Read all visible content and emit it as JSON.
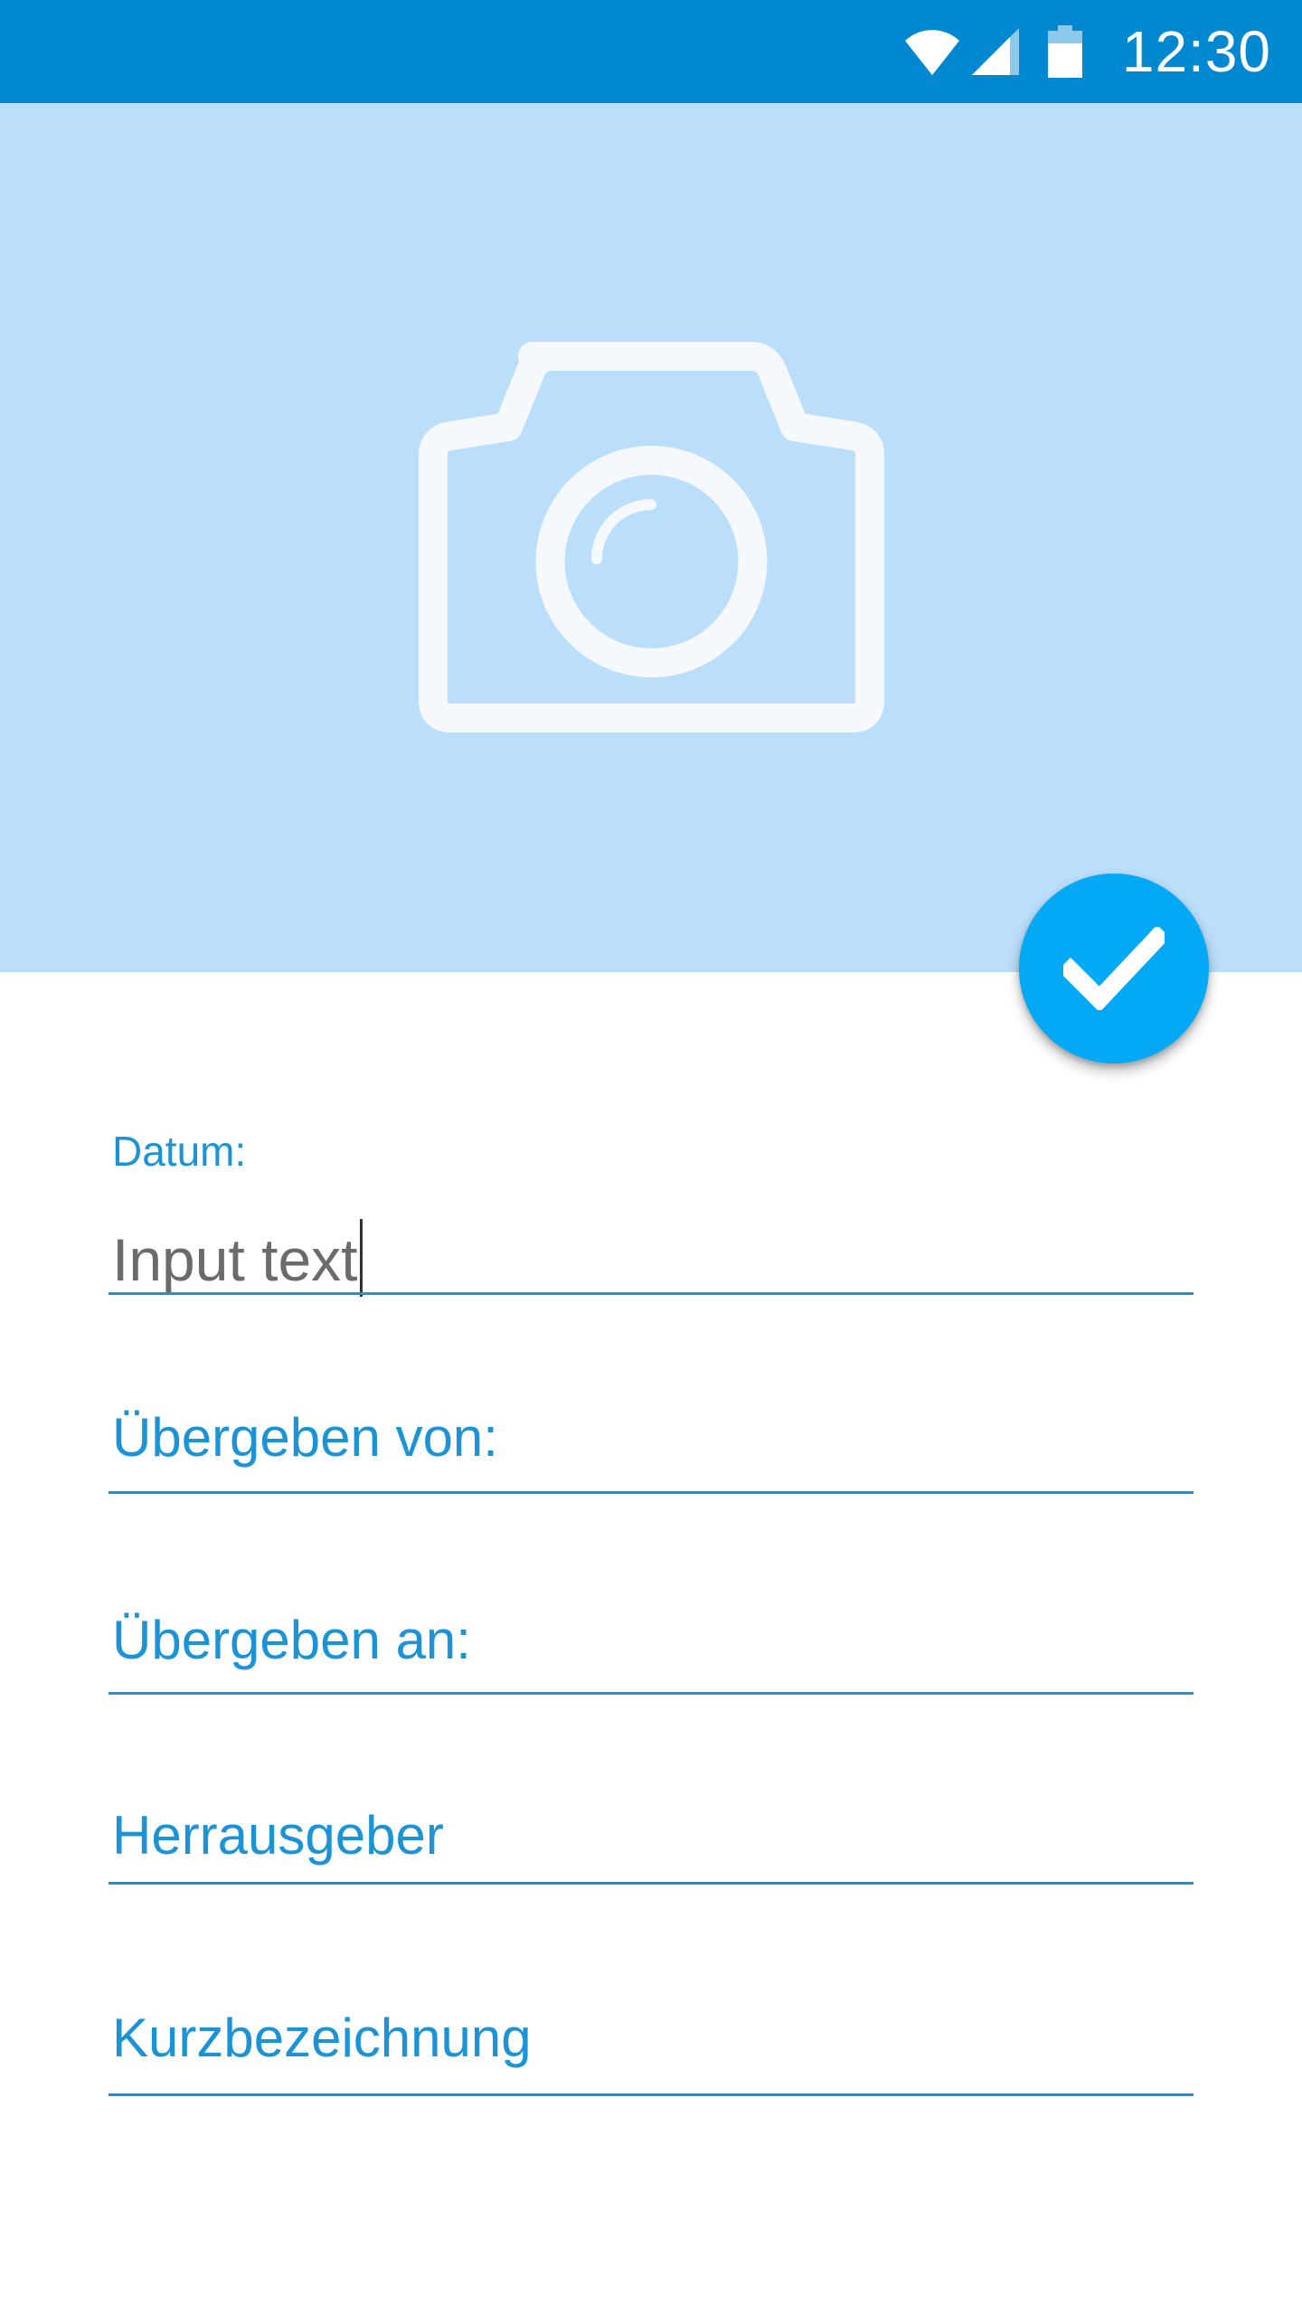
{
  "status_bar": {
    "time": "12:30",
    "background_color": "#0288d1",
    "icons": [
      "wifi-icon",
      "cellular-signal-icon",
      "battery-icon"
    ]
  },
  "header": {
    "background_color": "#bbdefa",
    "icon": "camera-icon"
  },
  "fab": {
    "icon": "check-icon",
    "color": "#03a9f4"
  },
  "form": {
    "accent_color": "#1c93d5",
    "datum": {
      "label": "Datum:",
      "value": "Input text"
    },
    "fields": [
      {
        "placeholder": "Übergeben von:"
      },
      {
        "placeholder": "Übergeben an:"
      },
      {
        "placeholder": "Herrausgeber"
      },
      {
        "placeholder": "Kurzbezeichnung"
      }
    ]
  }
}
